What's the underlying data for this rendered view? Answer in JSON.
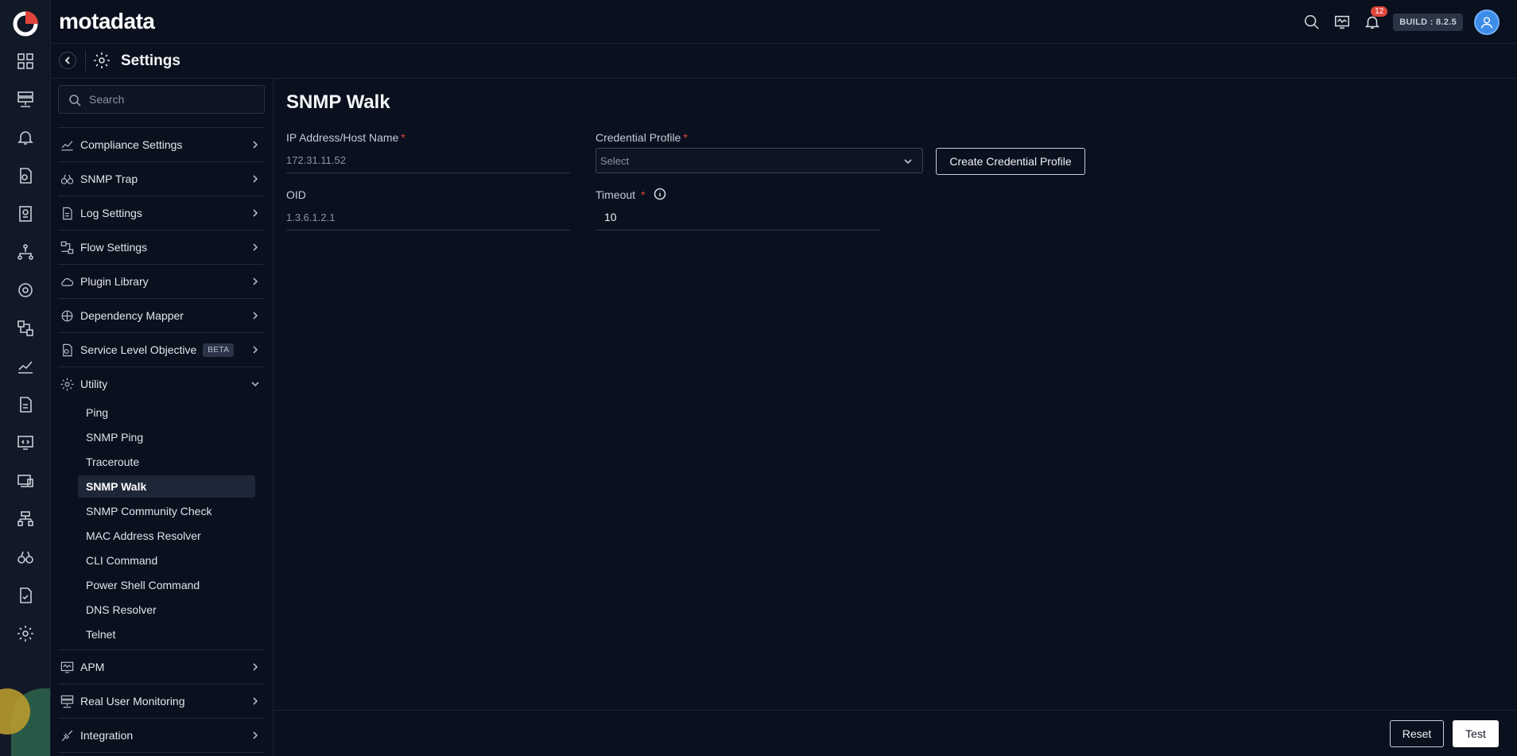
{
  "app": {
    "brand": "motadata"
  },
  "topbar": {
    "notification_count": "12",
    "build": "BUILD : 8.2.5"
  },
  "settings_header": {
    "title": "Settings"
  },
  "sidebar": {
    "search_placeholder": "Search",
    "items": [
      {
        "label": "Compliance Settings",
        "icon": "compliance-icon"
      },
      {
        "label": "SNMP Trap",
        "icon": "binoculars-icon"
      },
      {
        "label": "Log Settings",
        "icon": "log-icon"
      },
      {
        "label": "Flow Settings",
        "icon": "flow-icon"
      },
      {
        "label": "Plugin Library",
        "icon": "cloud-icon"
      },
      {
        "label": "Dependency Mapper",
        "icon": "dependency-icon"
      },
      {
        "label": "Service Level Objective",
        "icon": "slo-icon",
        "badge": "BETA"
      },
      {
        "label": "Utility",
        "icon": "utility-icon"
      }
    ],
    "utility_sub": [
      "Ping",
      "SNMP Ping",
      "Traceroute",
      "SNMP Walk",
      "SNMP Community Check",
      "MAC Address Resolver",
      "CLI Command",
      "Power Shell Command",
      "DNS Resolver",
      "Telnet"
    ],
    "active_sub": "SNMP Walk",
    "bottom_items": [
      {
        "label": "APM",
        "icon": "apm-icon"
      },
      {
        "label": "Real User Monitoring",
        "icon": "rum-icon"
      },
      {
        "label": "Integration",
        "icon": "integration-icon"
      }
    ]
  },
  "main": {
    "title": "SNMP Walk",
    "ip_label": "IP Address/Host Name",
    "ip_value": "172.31.11.52",
    "credential_label": "Credential Profile",
    "credential_value": "Select",
    "create_button": "Create Credential Profile",
    "oid_label": "OID",
    "oid_value": "1.3.6.1.2.1",
    "timeout_label": "Timeout",
    "timeout_value": "10",
    "required_mark": "*"
  },
  "footer": {
    "reset": "Reset",
    "test": "Test"
  },
  "colors": {
    "background": "#0a101d",
    "rail": "#111826",
    "required": "#e0453c",
    "accent": "#3d8de8"
  }
}
